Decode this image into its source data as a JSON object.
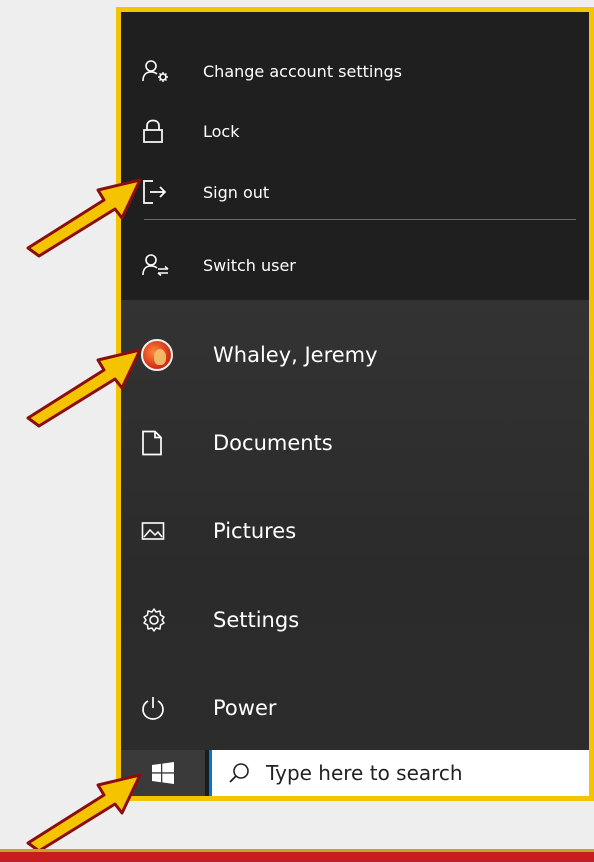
{
  "account_menu": {
    "items": [
      {
        "label": "Change account settings",
        "icon": "account-settings-icon"
      },
      {
        "label": "Lock",
        "icon": "lock-icon"
      },
      {
        "label": "Sign out",
        "icon": "sign-out-icon"
      },
      {
        "label": "Switch user",
        "icon": "switch-user-icon"
      }
    ]
  },
  "start_menu": {
    "items": [
      {
        "label": "Whaley, Jeremy",
        "icon": "user-avatar"
      },
      {
        "label": "Documents",
        "icon": "document-icon"
      },
      {
        "label": "Pictures",
        "icon": "pictures-icon"
      },
      {
        "label": "Settings",
        "icon": "gear-icon"
      },
      {
        "label": "Power",
        "icon": "power-icon"
      }
    ]
  },
  "taskbar": {
    "search_placeholder": "Type here to search"
  },
  "colors": {
    "frame_border": "#f5c400",
    "arrow_fill": "#f5c400",
    "arrow_outline": "#8b0e0e",
    "menu_bg": "#1f1f1f",
    "list_bg": "#2b2b2b",
    "accent_blue": "#0078d7"
  }
}
